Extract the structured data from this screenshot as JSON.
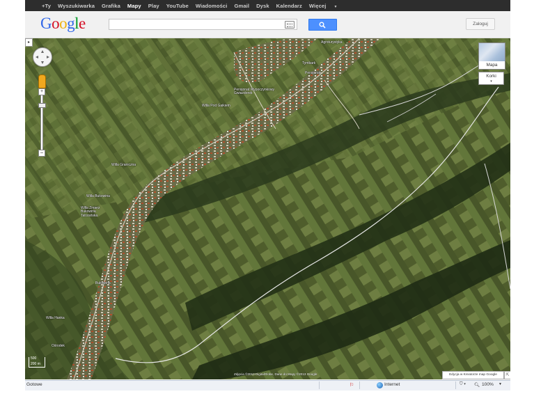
{
  "nav": {
    "items": [
      "+Ty",
      "Wyszukiwarka",
      "Grafika",
      "Mapy",
      "Play",
      "YouTube",
      "Wiadomości",
      "Gmail",
      "Dysk",
      "Kalendarz",
      "Więcej"
    ],
    "active": "Mapy"
  },
  "header": {
    "logo_letters": [
      "G",
      "o",
      "o",
      "g",
      "l",
      "e"
    ],
    "search_value": "",
    "login_label": "Zaloguj"
  },
  "map": {
    "collapse_glyph": "▸",
    "zoom_plus": "+",
    "zoom_minus": "−",
    "maptype_label": "Mapa",
    "traffic_label": "Korki",
    "traffic_caret": "▾",
    "scale_top": "500",
    "scale_bottom": "200 m",
    "copyright": "Zdjęcia ©2013 DigitalGlobe, Dane do Mapy ©2013 Google",
    "edit_link": "Edycja w Kreatorze map Google",
    "labels": [
      {
        "text": "Agroturystyka"
      },
      {
        "text": "Tymbark"
      },
      {
        "text": "Pensjonat"
      },
      {
        "text": "Pensjonat Wypoczynkowy Gwiazdorek"
      },
      {
        "text": "Willa Pod Gaikiem"
      },
      {
        "text": "Willa Graniczna"
      },
      {
        "text": "Willa Bukowina"
      },
      {
        "text": "Willa Zmierz Bukowina Tatrzańska"
      },
      {
        "text": "Bukowina"
      },
      {
        "text": "Willa Hanka"
      },
      {
        "text": "Ośrodek"
      }
    ]
  },
  "status": {
    "left": "Gotowe",
    "zone": "Internet",
    "zoom": "100%"
  },
  "colors": {
    "nav_bg": "#2d2d2d",
    "search_button": "#4d90fe",
    "header_bg": "#f1f1f1"
  }
}
